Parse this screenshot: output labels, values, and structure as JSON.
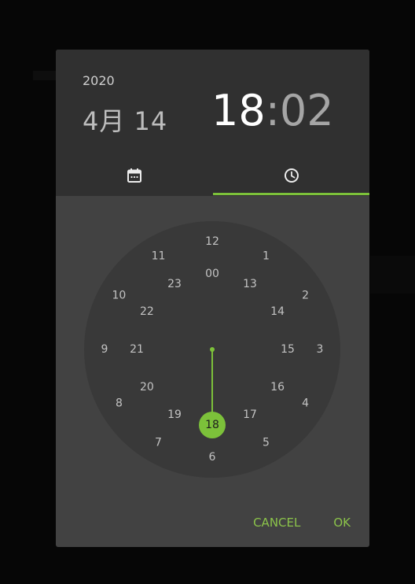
{
  "header": {
    "year": "2020",
    "date": "4月 14",
    "hour": "18",
    "separator": ":",
    "minute": "02"
  },
  "tabs": [
    {
      "name": "date",
      "icon": "calendar-icon",
      "selected": false
    },
    {
      "name": "clock",
      "icon": "clock-icon",
      "selected": true
    }
  ],
  "clock": {
    "outer_hours": [
      "12",
      "1",
      "2",
      "3",
      "4",
      "5",
      "6",
      "7",
      "8",
      "9",
      "10",
      "11"
    ],
    "inner_hours": [
      "00",
      "13",
      "14",
      "15",
      "16",
      "17",
      "18",
      "19",
      "20",
      "21",
      "22",
      "23"
    ],
    "selected_hour": "18"
  },
  "actions": {
    "cancel": "CANCEL",
    "ok": "OK"
  },
  "colors": {
    "accent": "#8bc34a",
    "dialog_bg": "#424242",
    "header_bg": "#303030",
    "clock_face": "#393939"
  }
}
